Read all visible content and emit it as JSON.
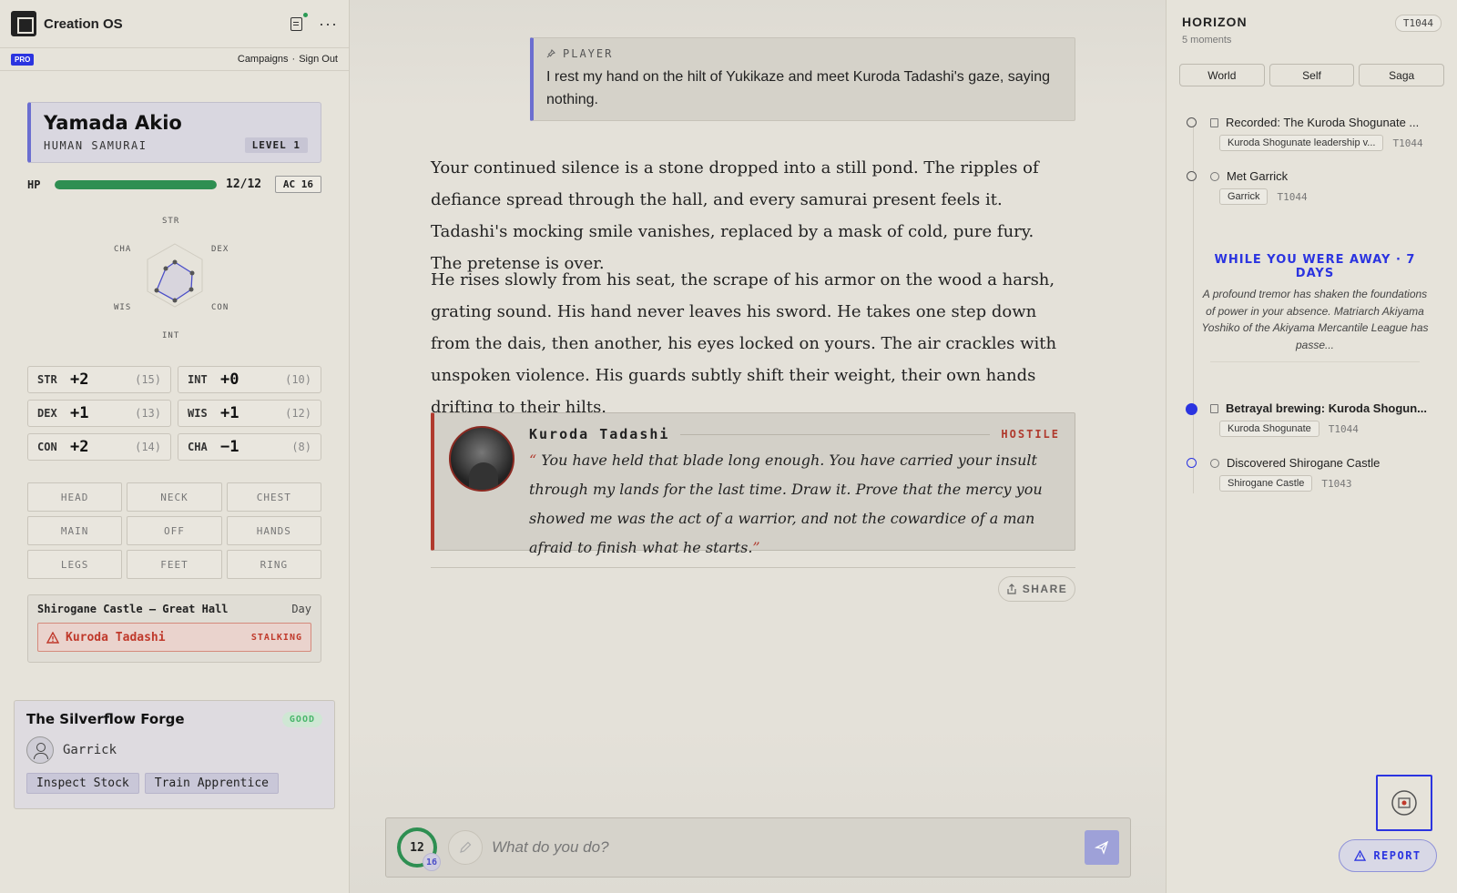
{
  "app": {
    "title": "Creation OS",
    "badge": "PRO",
    "links": [
      "Campaigns",
      "Sign Out"
    ],
    "link_sep": "·"
  },
  "character": {
    "name": "Yamada Akio",
    "class": "HUMAN SAMURAI",
    "level": "LEVEL 1",
    "hp_label": "HP",
    "hp_text": "12/12",
    "hp_fraction": 1.0,
    "ac": "AC 16",
    "radar_labels": [
      "STR",
      "DEX",
      "CON",
      "INT",
      "WIS",
      "CHA"
    ],
    "stats": [
      {
        "abbr": "STR",
        "mod": "+2",
        "score": "(15)"
      },
      {
        "abbr": "INT",
        "mod": "+0",
        "score": "(10)"
      },
      {
        "abbr": "DEX",
        "mod": "+1",
        "score": "(13)"
      },
      {
        "abbr": "WIS",
        "mod": "+1",
        "score": "(12)"
      },
      {
        "abbr": "CON",
        "mod": "+2",
        "score": "(14)"
      },
      {
        "abbr": "CHA",
        "mod": "−1",
        "score": "(8)"
      }
    ],
    "equipment": [
      "HEAD",
      "NECK",
      "CHEST",
      "MAIN",
      "OFF",
      "HANDS",
      "LEGS",
      "FEET",
      "RING"
    ]
  },
  "location": {
    "name": "Shirogane Castle — Great Hall",
    "time": "Day",
    "threat_name": "Kuroda Tadashi",
    "threat_status": "STALKING"
  },
  "shop": {
    "title": "The Silverflow Forge",
    "status": "GOOD",
    "npc": "Garrick",
    "actions": [
      "Inspect Stock",
      "Train Apprentice"
    ]
  },
  "story": {
    "player_label": "PLAYER",
    "player_text": "I rest my hand on the hilt of Yukikaze and meet Kuroda Tadashi's gaze, saying nothing.",
    "paragraphs": [
      "Your continued silence is a stone dropped into a still pond. The ripples of defiance spread through the hall, and every samurai present feels it. Tadashi's mocking smile vanishes, replaced by a mask of cold, pure fury. The pretense is over.",
      "He rises slowly from his seat, the scrape of his armor on the wood a harsh, grating sound. His hand never leaves his sword. He takes one step down from the dais, then another, his eyes locked on yours. The air crackles with unspoken violence. His guards subtly shift their weight, their own hands drifting to their hilts."
    ],
    "dialog": {
      "speaker": "Kuroda Tadashi",
      "disposition": "HOSTILE",
      "open_quote": "“",
      "close_quote": "”",
      "text": "You have held that blade long enough. You have carried your insult through my lands for the last time. Draw it. Prove that the mercy you showed me was the act of a warrior, and not the cowardice of a man afraid to finish what he starts."
    },
    "share_label": "SHARE"
  },
  "input": {
    "hp_ring": "12",
    "ring_sub": "16",
    "placeholder": "What do you do?"
  },
  "horizon": {
    "title": "HORIZON",
    "subtitle": "5 moments",
    "turn": "T1044",
    "tabs": [
      "World",
      "Self",
      "Saga"
    ],
    "events": [
      {
        "title": "Recorded: The Kuroda Shogunate ...",
        "tag": "Kuroda Shogunate leadership v...",
        "turn": "T1044"
      },
      {
        "title": "Met Garrick",
        "tag": "Garrick",
        "turn": "T1044"
      },
      {
        "title": "Betrayal brewing: Kuroda Shogun...",
        "tag": "Kuroda Shogunate",
        "turn": "T1044"
      },
      {
        "title": "Discovered Shirogane Castle",
        "tag": "Shirogane Castle",
        "turn": "T1043"
      }
    ],
    "away_title": "WHILE YOU WERE AWAY · 7 DAYS",
    "away_text": "A profound tremor has shaken the foundations of power in your absence. Matriarch Akiyama Yoshiko of the Akiyama Mercantile League has passe...",
    "report_label": "REPORT"
  },
  "colors": {
    "accent": "#2b34e0",
    "hp": "#2e8f52",
    "hostile": "#b03a2e",
    "good": "#48b56a"
  }
}
